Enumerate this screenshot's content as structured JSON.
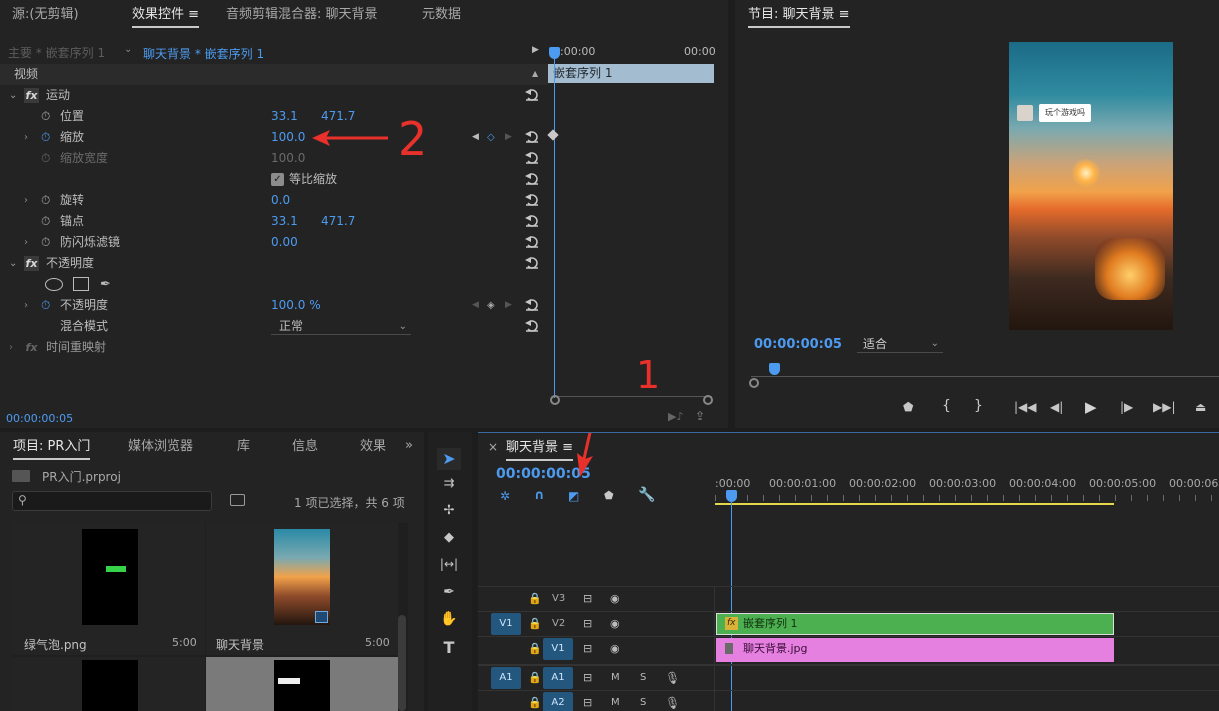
{
  "source_panel": {
    "tabs": [
      "源:(无剪辑)",
      "效果控件",
      "音频剪辑混合器: 聊天背景",
      "元数据"
    ],
    "active_tab": "效果控件",
    "master_label": "主要 * 嵌套序列 1",
    "clip_label": "聊天背景 * 嵌套序列 1",
    "time_start": ":00:00",
    "time_end": "00:00",
    "clip_bar": "嵌套序列 1",
    "video_header": "视频",
    "motion": "运动",
    "position_label": "位置",
    "position_x": "33.1",
    "position_y": "471.7",
    "scale_label": "缩放",
    "scale_value": "100.0",
    "scale_width_label": "缩放宽度",
    "scale_width_value": "100.0",
    "uniform_scale": "等比缩放",
    "rotation_label": "旋转",
    "rotation_value": "0.0",
    "anchor_label": "锚点",
    "anchor_x": "33.1",
    "anchor_y": "471.7",
    "flicker_label": "防闪烁滤镜",
    "flicker_value": "0.00",
    "opacity_group": "不透明度",
    "opacity_label": "不透明度",
    "opacity_value": "100.0",
    "opacity_unit": "%",
    "blend_label": "混合模式",
    "blend_value": "正常",
    "time_remap": "时间重映射",
    "timecode": "00:00:00:05",
    "annotation_2": "2"
  },
  "program_panel": {
    "title": "节目: 聊天背景",
    "timecode": "00:00:00:05",
    "fit": "适合",
    "bubble_text": "玩个游戏吗"
  },
  "project_panel": {
    "tabs": [
      "项目: PR入门",
      "媒体浏览器",
      "库",
      "信息",
      "效果"
    ],
    "file": "PR入门.prproj",
    "selection_info": "1 项已选择，共 6 项",
    "items": [
      {
        "name": "绿气泡.png",
        "duration": "5:00"
      },
      {
        "name": "聊天背景",
        "duration": "5:00"
      }
    ]
  },
  "timeline_panel": {
    "close": "×",
    "title": "聊天背景",
    "timecode": "00:00:00:05",
    "ruler": [
      ":00:00",
      "00:00:01:00",
      "00:00:02:00",
      "00:00:03:00",
      "00:00:04:00",
      "00:00:05:00",
      "00:00:06:0"
    ],
    "tracks": {
      "v3": "V3",
      "v2": "V2",
      "v1": "V1",
      "a1": "A1",
      "a2": "A2",
      "v1_src": "V1",
      "a1_src": "A1",
      "m": "M",
      "s": "S"
    },
    "clip_nested": "嵌套序列 1",
    "clip_fx": "fx",
    "clip_bg": "聊天背景.jpg",
    "annotation_1": "1"
  },
  "colors": {
    "accent_blue": "#4d9bf0",
    "annotation_red": "#e8312b",
    "clip_green": "#4caf50",
    "clip_pink": "#e57fe0"
  }
}
